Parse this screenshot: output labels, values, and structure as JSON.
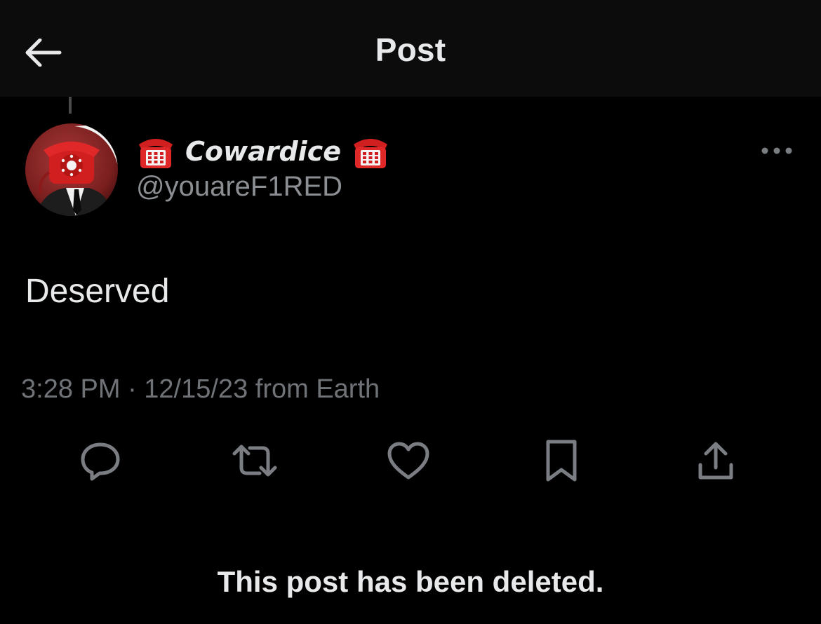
{
  "header": {
    "title": "Post",
    "back_icon": "arrow-left-icon"
  },
  "post": {
    "author": {
      "display_name": "Cowardice",
      "handle": "@youareF1RED",
      "name_emoji_icon": "telephone-icon",
      "avatar": "avatar-red-telephone-head"
    },
    "text": "Deserved",
    "meta": "3:28 PM · 12/15/23 from Earth",
    "more_icon": "more-dots-icon"
  },
  "actions": [
    {
      "name": "reply",
      "icon": "reply-bubble-icon"
    },
    {
      "name": "repost",
      "icon": "repost-arrows-icon"
    },
    {
      "name": "like",
      "icon": "heart-icon"
    },
    {
      "name": "bookmark",
      "icon": "bookmark-icon"
    },
    {
      "name": "share",
      "icon": "share-upload-icon"
    }
  ],
  "notice": "This post has been deleted.",
  "colors": {
    "background": "#000000",
    "header_bg": "#0c0c0c",
    "primary_text": "#e7e9ea",
    "secondary_text": "#8b8e92",
    "icon_gray": "#7a7e83",
    "telephone_red": "#d11f1f"
  }
}
